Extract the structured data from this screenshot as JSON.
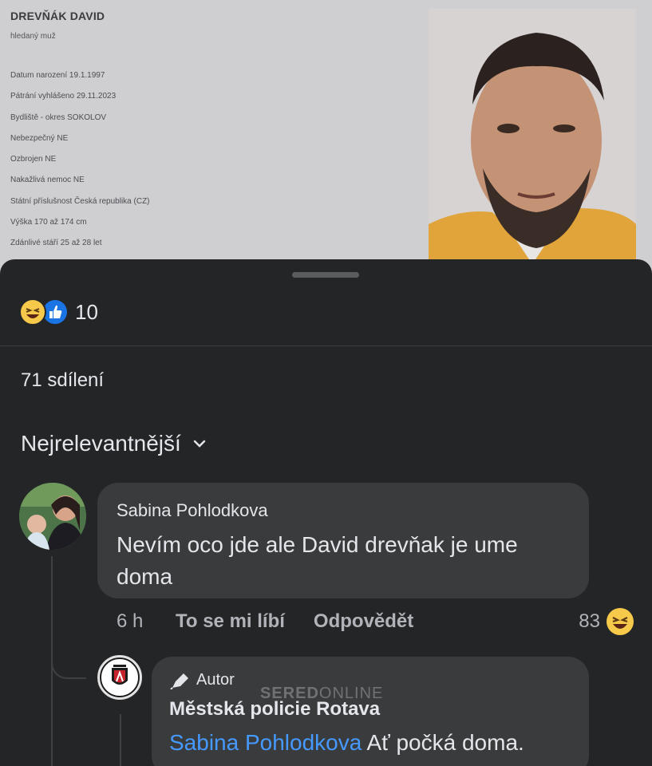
{
  "wanted": {
    "name": "DREVŇÁK DAVID",
    "subtitle": "hledaný muž",
    "facts": [
      "Datum narození 19.1.1997",
      "Pátrání vyhlášeno 29.11.2023",
      "Bydliště - okres SOKOLOV",
      "Nebezpečný NE",
      "Ozbrojen NE",
      "Nakažlivá nemoc NE",
      "Státní příslušnost Česká republika (CZ)",
      "Výška 170 až 174 cm",
      "Zdánlivé stáří 25 až 28 let"
    ]
  },
  "post": {
    "reaction_icons": [
      "laugh-reaction-icon",
      "like-reaction-icon"
    ],
    "reaction_count": "10",
    "shares": "71 sdílení",
    "sort_label": "Nejrelevantnější"
  },
  "comment": {
    "author": "Sabina Pohlodkova",
    "text": "Nevím oco jde ale David drevňak je ume doma",
    "time": "6 h",
    "like_label": "To se mi líbí",
    "reply_label": "Odpovědět",
    "reaction_count": "83"
  },
  "reply": {
    "badge": "Autor",
    "author": "Městská policie Rotava",
    "mention": "Sabina Pohlodkova",
    "text": " Ať počká doma."
  },
  "watermark": {
    "bold": "SERED",
    "light": "ONLINE"
  },
  "colors": {
    "sheet_bg": "#242527",
    "bubble_bg": "#3a3b3c",
    "mention": "#4599ff",
    "laugh": "#f7c94a",
    "like": "#1b74e4"
  }
}
